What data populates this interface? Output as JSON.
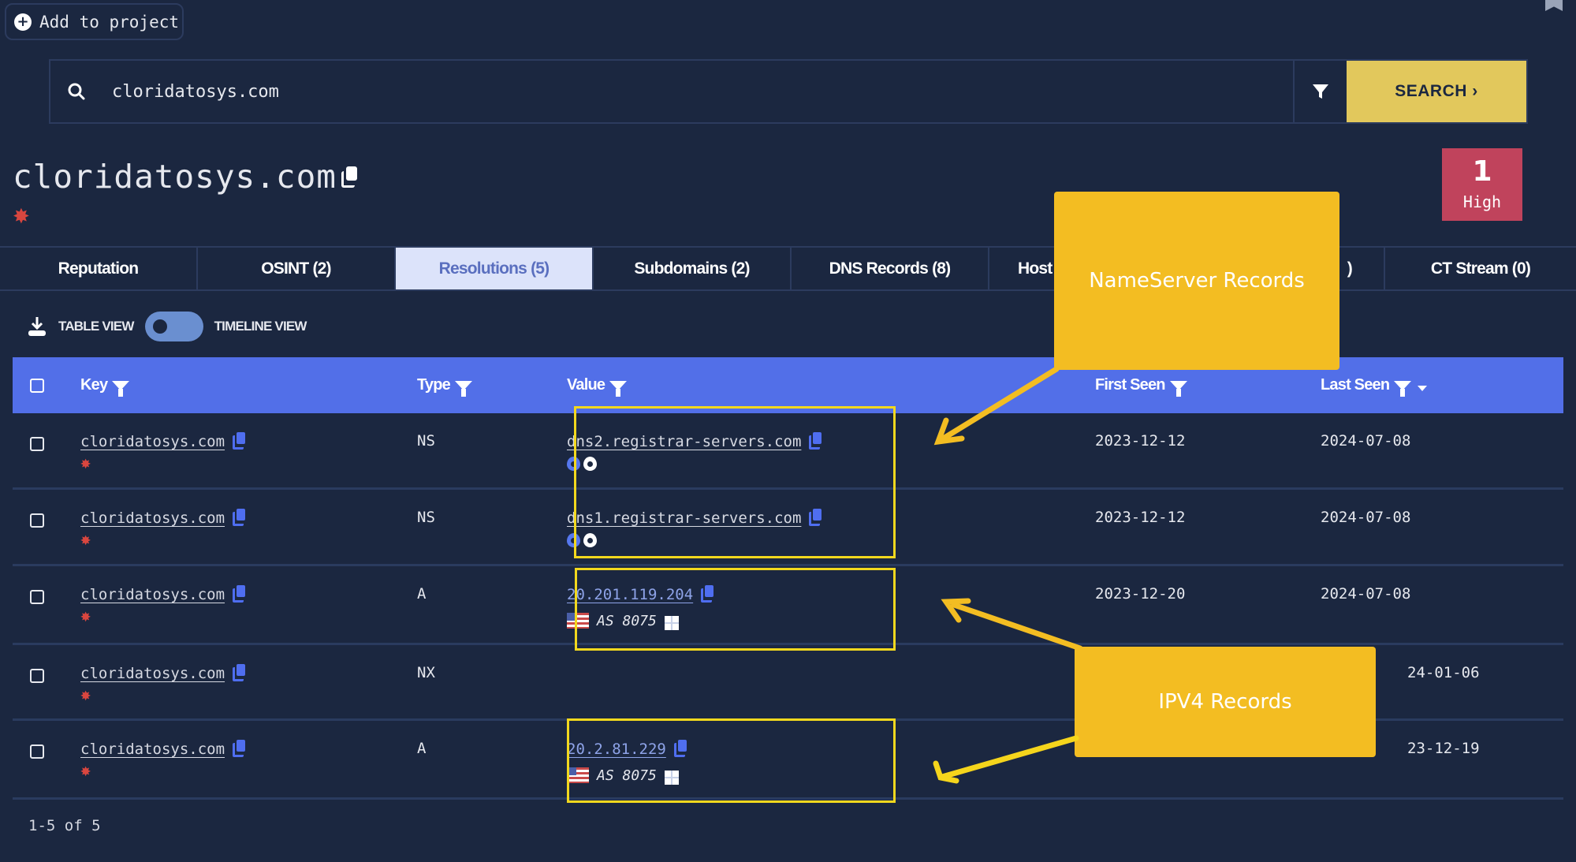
{
  "header": {
    "add_to_project_label": "Add to project",
    "search_value": "cloridatosys.com",
    "search_button_label": "SEARCH ›"
  },
  "entity": {
    "title": "cloridatosys.com",
    "risk_count": "1",
    "risk_label": "High",
    "risk_color": "#c0435c"
  },
  "tabs": [
    {
      "label": "Reputation",
      "active": false
    },
    {
      "label": "OSINT (2)",
      "active": false
    },
    {
      "label": "Resolutions (5)",
      "active": true
    },
    {
      "label": "Subdomains (2)",
      "active": false
    },
    {
      "label": "DNS Records (8)",
      "active": false
    },
    {
      "label": "Host C",
      "active": false
    },
    {
      "label": ")",
      "active": false
    },
    {
      "label": "CT Stream (0)",
      "active": false
    }
  ],
  "view_toggle": {
    "left_label": "TABLE VIEW",
    "right_label": "TIMELINE VIEW"
  },
  "table": {
    "columns": [
      "Key",
      "Type",
      "Value",
      "First Seen",
      "Last Seen"
    ],
    "rows": [
      {
        "key": "cloridatosys.com",
        "type": "NS",
        "value": "dns2.registrar-servers.com",
        "value_kind": "ns",
        "asn": "",
        "first_seen": "2023-12-12",
        "last_seen": "2024-07-08"
      },
      {
        "key": "cloridatosys.com",
        "type": "NS",
        "value": "dns1.registrar-servers.com",
        "value_kind": "ns",
        "asn": "",
        "first_seen": "2023-12-12",
        "last_seen": "2024-07-08"
      },
      {
        "key": "cloridatosys.com",
        "type": "A",
        "value": "20.201.119.204",
        "value_kind": "ip",
        "asn": "AS 8075",
        "first_seen": "2023-12-20",
        "last_seen": "2024-07-08"
      },
      {
        "key": "cloridatosys.com",
        "type": "NX",
        "value": "",
        "value_kind": "none",
        "asn": "",
        "first_seen": "",
        "last_seen": "24-01-06"
      },
      {
        "key": "cloridatosys.com",
        "type": "A",
        "value": "20.2.81.229",
        "value_kind": "ip",
        "asn": "AS 8075",
        "first_seen": "",
        "last_seen": "23-12-19"
      }
    ]
  },
  "pager": {
    "text": "1-5 of 5"
  },
  "annotations": {
    "nameserver_label": "NameServer Records",
    "ipv4_label": "IPV4 Records",
    "callout_color": "#f3bd22",
    "highlight_color": "#f2d81e"
  },
  "colors": {
    "background": "#1b2740",
    "table_header": "#526fe8",
    "search_button": "#e2c85c",
    "active_tab": "#dce3fa"
  }
}
